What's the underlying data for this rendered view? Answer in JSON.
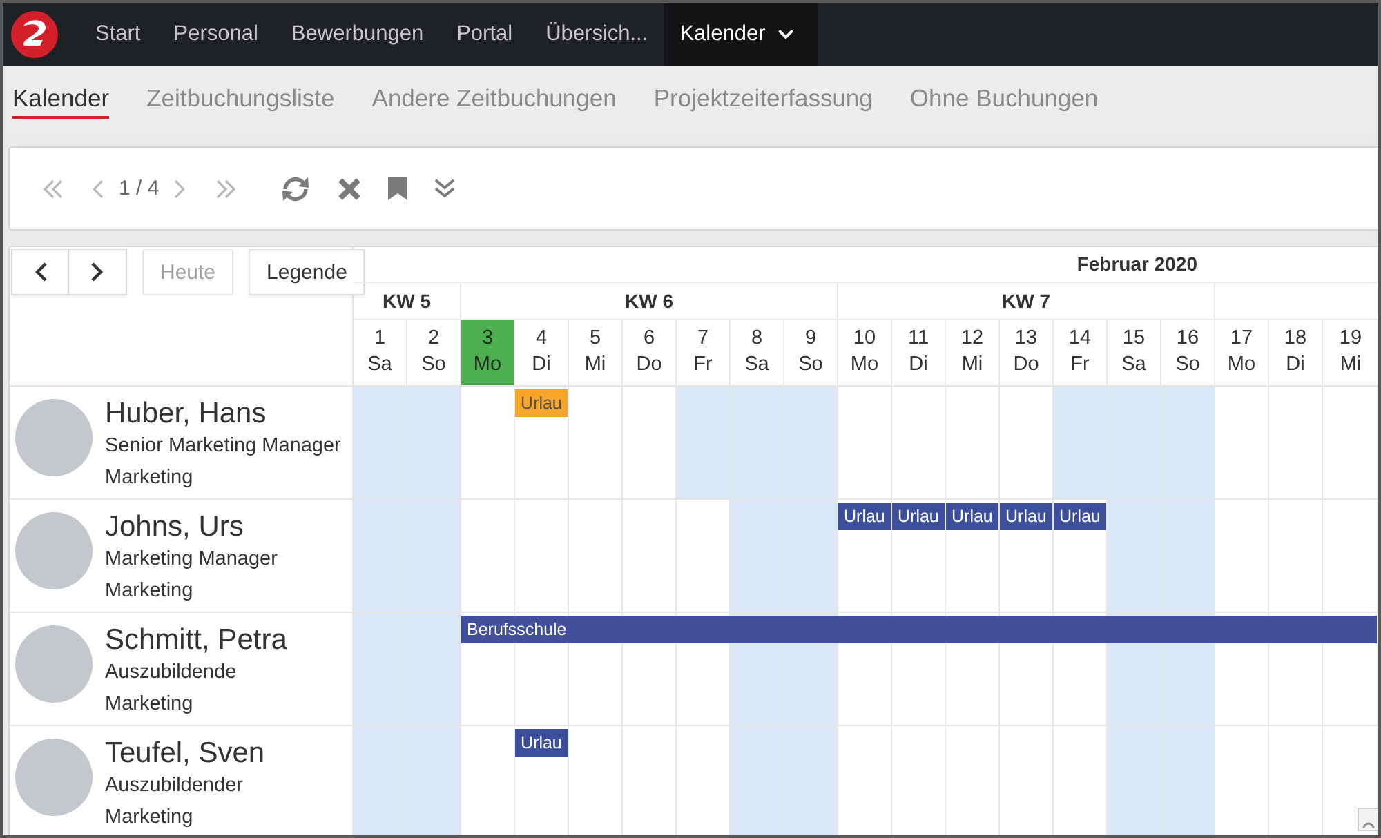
{
  "top_nav": {
    "items": [
      {
        "label": "Start",
        "selected": false,
        "dropdown": false
      },
      {
        "label": "Personal",
        "selected": false,
        "dropdown": false
      },
      {
        "label": "Bewerbungen",
        "selected": false,
        "dropdown": false
      },
      {
        "label": "Portal",
        "selected": false,
        "dropdown": false
      },
      {
        "label": "Übersich...",
        "selected": false,
        "dropdown": false
      },
      {
        "label": "Kalender",
        "selected": true,
        "dropdown": true
      }
    ]
  },
  "tabs": [
    {
      "label": "Kalender",
      "selected": true
    },
    {
      "label": "Zeitbuchungsliste",
      "selected": false
    },
    {
      "label": "Andere Zeitbuchungen",
      "selected": false
    },
    {
      "label": "Projektzeiterfassung",
      "selected": false
    },
    {
      "label": "Ohne Buchungen",
      "selected": false
    }
  ],
  "toolbar": {
    "page": "1 / 4"
  },
  "calendar": {
    "buttons": [
      {
        "label": "Heute",
        "disabled": true
      },
      {
        "label": "Legende",
        "disabled": false
      }
    ],
    "month": "Februar 2020",
    "weeks": [
      {
        "label": "KW 5",
        "days": [
          {
            "number": "1",
            "weekday": "Sa",
            "today": false
          },
          {
            "number": "2",
            "weekday": "So",
            "today": false
          }
        ]
      },
      {
        "label": "KW 6",
        "days": [
          {
            "number": "3",
            "weekday": "Mo",
            "today": true
          },
          {
            "number": "4",
            "weekday": "Di",
            "today": false
          },
          {
            "number": "5",
            "weekday": "Mi",
            "today": false
          },
          {
            "number": "6",
            "weekday": "Do",
            "today": false
          },
          {
            "number": "7",
            "weekday": "Fr",
            "today": false
          },
          {
            "number": "8",
            "weekday": "Sa",
            "today": false
          },
          {
            "number": "9",
            "weekday": "So",
            "today": false
          }
        ]
      },
      {
        "label": "KW 7",
        "days": [
          {
            "number": "10",
            "weekday": "Mo",
            "today": false
          },
          {
            "number": "11",
            "weekday": "Di",
            "today": false
          },
          {
            "number": "12",
            "weekday": "Mi",
            "today": false
          },
          {
            "number": "13",
            "weekday": "Do",
            "today": false
          },
          {
            "number": "14",
            "weekday": "Fr",
            "today": false
          },
          {
            "number": "15",
            "weekday": "Sa",
            "today": false
          },
          {
            "number": "16",
            "weekday": "So",
            "today": false
          }
        ]
      },
      {
        "days": [
          {
            "number": "17",
            "weekday": "Mo",
            "today": false
          },
          {
            "number": "18",
            "weekday": "Di",
            "today": false
          },
          {
            "number": "19",
            "weekday": "Mi",
            "today": false
          }
        ]
      }
    ],
    "employees": [
      {
        "name": "Huber, Hans",
        "title": "Senior Marketing Manager",
        "department": "Marketing",
        "days": [
          {
            "off": true
          },
          {
            "off": true
          },
          {
            "off": false
          },
          {
            "off": false,
            "booking": {
              "kind": "start",
              "label": "Urlau",
              "color": "#f6a52a"
            }
          },
          {
            "off": false
          },
          {
            "off": false
          },
          {
            "off": true
          },
          {
            "off": true
          },
          {
            "off": true
          },
          {
            "off": false
          },
          {
            "off": false
          },
          {
            "off": false
          },
          {
            "off": false
          },
          {
            "off": true
          },
          {
            "off": true
          },
          {
            "off": true
          },
          {
            "off": false
          },
          {
            "off": false
          },
          {
            "off": false
          }
        ]
      },
      {
        "name": "Johns, Urs",
        "title": "Marketing Manager",
        "department": "Marketing",
        "days": [
          {
            "off": true
          },
          {
            "off": true
          },
          {
            "off": false
          },
          {
            "off": false
          },
          {
            "off": false
          },
          {
            "off": false
          },
          {
            "off": false
          },
          {
            "off": true
          },
          {
            "off": true
          },
          {
            "off": false,
            "booking": {
              "kind": "start",
              "label": "Urlau",
              "color": "#3b4f9d"
            }
          },
          {
            "off": false,
            "booking": {
              "kind": "start",
              "label": "Urlau",
              "color": "#3b4f9d"
            }
          },
          {
            "off": false,
            "booking": {
              "kind": "start",
              "label": "Urlau",
              "color": "#3b4f9d"
            }
          },
          {
            "off": false,
            "booking": {
              "kind": "start",
              "label": "Urlau",
              "color": "#3b4f9d"
            }
          },
          {
            "off": false,
            "booking": {
              "kind": "start",
              "label": "Urlau",
              "color": "#3b4f9d"
            }
          },
          {
            "off": true
          },
          {
            "off": true
          },
          {
            "off": false
          },
          {
            "off": false
          },
          {
            "off": false
          }
        ]
      },
      {
        "name": "Schmitt, Petra",
        "title": "Auszubildende",
        "department": "Marketing",
        "days": [
          {
            "off": true
          },
          {
            "off": true
          },
          {
            "off": false,
            "booking": {
              "kind": "start",
              "label": "Berufsschule",
              "color": "#42509c"
            }
          },
          {
            "off": false,
            "booking": {
              "kind": "continued"
            }
          },
          {
            "off": false,
            "booking": {
              "kind": "continued"
            }
          },
          {
            "off": false,
            "booking": {
              "kind": "continued"
            }
          },
          {
            "off": false,
            "booking": {
              "kind": "continued"
            }
          },
          {
            "off": true,
            "booking": {
              "kind": "continued"
            }
          },
          {
            "off": true,
            "booking": {
              "kind": "continued"
            }
          },
          {
            "off": false,
            "booking": {
              "kind": "continued"
            }
          },
          {
            "off": false,
            "booking": {
              "kind": "continued"
            }
          },
          {
            "off": false,
            "booking": {
              "kind": "continued"
            }
          },
          {
            "off": false,
            "booking": {
              "kind": "continued"
            }
          },
          {
            "off": false,
            "booking": {
              "kind": "continued"
            }
          },
          {
            "off": true,
            "booking": {
              "kind": "continued"
            }
          },
          {
            "off": true,
            "booking": {
              "kind": "continued"
            }
          },
          {
            "off": false,
            "booking": {
              "kind": "continued"
            }
          },
          {
            "off": false,
            "booking": {
              "kind": "continued"
            }
          },
          {
            "off": false,
            "booking": {
              "kind": "continued"
            }
          }
        ]
      },
      {
        "name": "Teufel, Sven",
        "title": "Auszubildender",
        "department": "Marketing",
        "days": [
          {
            "off": true
          },
          {
            "off": true
          },
          {
            "off": false
          },
          {
            "off": false,
            "booking": {
              "kind": "start",
              "label": "Urlau",
              "color": "#3b4f9d"
            }
          },
          {
            "off": false
          },
          {
            "off": false
          },
          {
            "off": false
          },
          {
            "off": true
          },
          {
            "off": true
          },
          {
            "off": false
          },
          {
            "off": false
          },
          {
            "off": false
          },
          {
            "off": false
          },
          {
            "off": false
          },
          {
            "off": true
          },
          {
            "off": true
          },
          {
            "off": false
          },
          {
            "off": false
          },
          {
            "off": false
          }
        ]
      }
    ]
  }
}
